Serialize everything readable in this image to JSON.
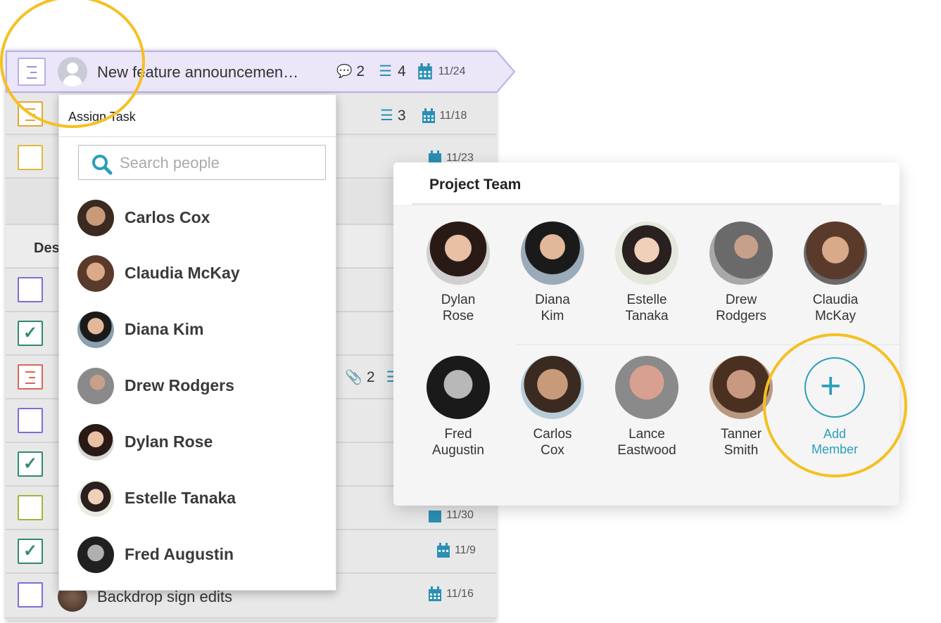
{
  "colors": {
    "accent": "#2a9fb8",
    "highlight": "#f5c021",
    "row_highlight": "#e8e3f7"
  },
  "tasks": {
    "first": {
      "title": "New feature announcemen…",
      "comments": "2",
      "subtasks": "4",
      "date": "11/24"
    },
    "rows": [
      {
        "subtasks": "3",
        "date": "11/18"
      },
      {
        "date": "11/23"
      },
      {
        "section": "Des"
      },
      {},
      {},
      {
        "attachments": "2"
      },
      {},
      {},
      {
        "date": "11/30"
      },
      {
        "date": "11/9"
      },
      {
        "title": "Backdrop sign edits",
        "date": "11/16"
      }
    ]
  },
  "assign": {
    "title": "Assign Task",
    "search_placeholder": "Search people",
    "people": [
      "Carlos Cox",
      "Claudia McKay",
      "Diana Kim",
      "Drew Rodgers",
      "Dylan Rose",
      "Estelle Tanaka",
      "Fred Augustin"
    ]
  },
  "team": {
    "title": "Project Team",
    "members": [
      {
        "first": "Dylan",
        "last": "Rose"
      },
      {
        "first": "Diana",
        "last": "Kim"
      },
      {
        "first": "Estelle",
        "last": "Tanaka"
      },
      {
        "first": "Drew",
        "last": "Rodgers"
      },
      {
        "first": "Claudia",
        "last": "McKay"
      },
      {
        "first": "Fred",
        "last": "Augustin"
      },
      {
        "first": "Carlos",
        "last": "Cox"
      },
      {
        "first": "Lance",
        "last": "Eastwood"
      },
      {
        "first": "Tanner",
        "last": "Smith"
      }
    ],
    "add_line1": "Add",
    "add_line2": "Member"
  }
}
